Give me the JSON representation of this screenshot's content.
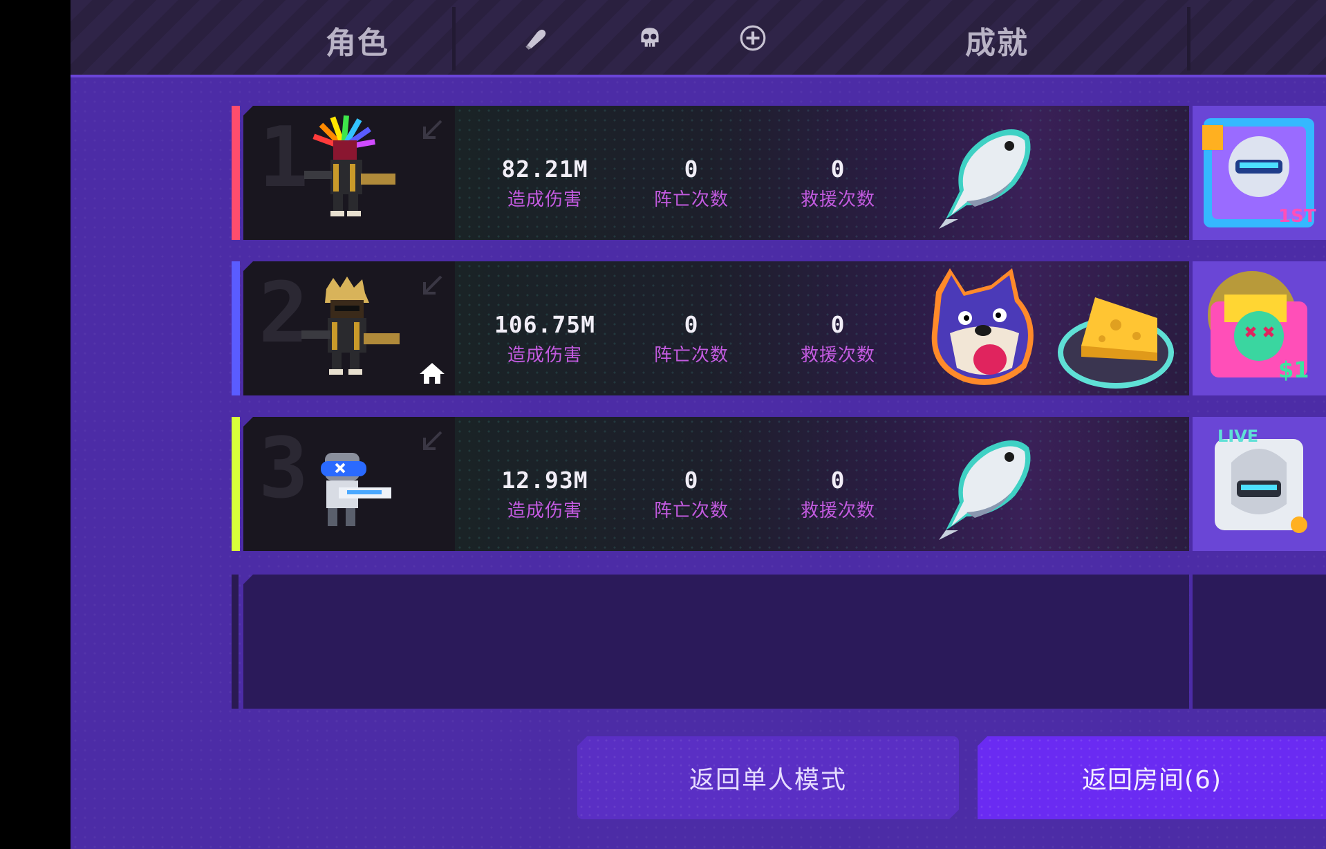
{
  "header": {
    "tab_character": "角色",
    "tab_achievement": "成就",
    "icons": [
      "bullet-icon",
      "skull-icon",
      "plus-circle-icon"
    ]
  },
  "colors": {
    "accent_row1": "#ff4d6d",
    "accent_row2": "#5a5cff",
    "accent_row3": "#d8ff3a",
    "stat_label": "#c35be0"
  },
  "rows": [
    {
      "rank": "1",
      "damage": "82.21M",
      "damage_label": "造成伤害",
      "deaths": "0",
      "deaths_label": "阵亡次数",
      "rescues": "0",
      "rescues_label": "救援次数",
      "is_host": false,
      "rewards": [
        "fish"
      ],
      "achievement_badge": "1ST"
    },
    {
      "rank": "2",
      "damage": "106.75M",
      "damage_label": "造成伤害",
      "deaths": "0",
      "deaths_label": "阵亡次数",
      "rescues": "0",
      "rescues_label": "救援次数",
      "is_host": true,
      "rewards": [
        "wolf",
        "cheese"
      ],
      "achievement_badge": "$1"
    },
    {
      "rank": "3",
      "damage": "12.93M",
      "damage_label": "造成伤害",
      "deaths": "0",
      "deaths_label": "阵亡次数",
      "rescues": "0",
      "rescues_label": "救援次数",
      "is_host": false,
      "rewards": [
        "fish"
      ],
      "achievement_badge": "LIVE"
    }
  ],
  "buttons": {
    "single_mode": "返回单人模式",
    "room": "返回房间(6)"
  }
}
